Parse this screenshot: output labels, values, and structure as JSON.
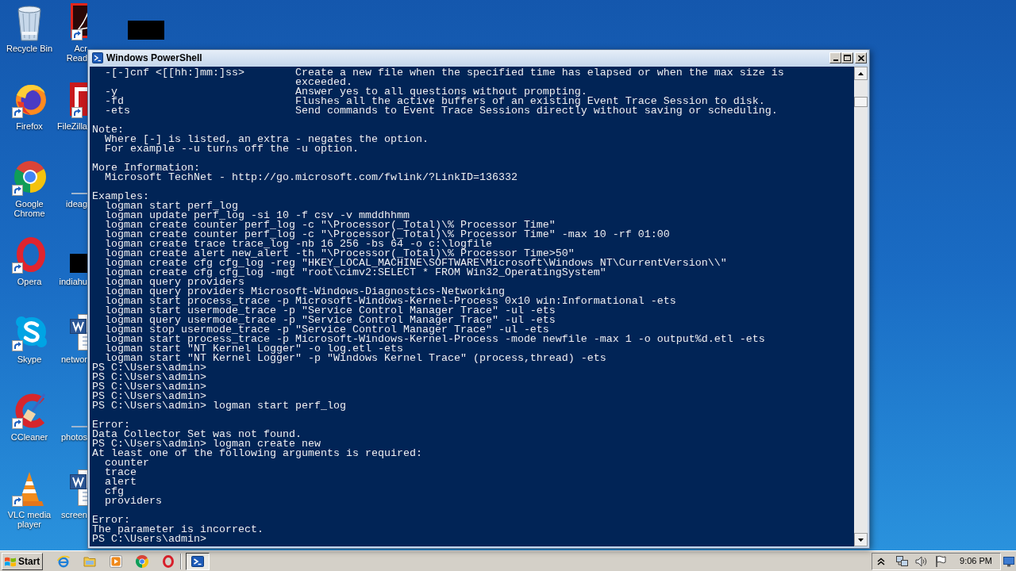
{
  "desktop": {
    "columns": [
      [
        {
          "kind": "recycle-bin",
          "label": [
            "Recycle Bin"
          ],
          "shortcut": false
        },
        {
          "kind": "firefox",
          "label": [
            "Firefox"
          ],
          "shortcut": true
        },
        {
          "kind": "chrome",
          "label": [
            "Google",
            "Chrome"
          ],
          "shortcut": true
        },
        {
          "kind": "opera",
          "label": [
            "Opera"
          ],
          "shortcut": true
        },
        {
          "kind": "skype",
          "label": [
            "Skype"
          ],
          "shortcut": true
        },
        {
          "kind": "ccleaner",
          "label": [
            "CCleaner"
          ],
          "shortcut": true
        },
        {
          "kind": "vlc",
          "label": [
            "VLC media",
            "player"
          ],
          "shortcut": true
        }
      ],
      [
        {
          "kind": "acrobat",
          "label": [
            "Acr",
            "Read"
          ],
          "shortcut": true
        },
        {
          "kind": "filezilla",
          "label": [
            "FileZilla"
          ],
          "shortcut": true
        },
        {
          "kind": "dash",
          "label": [
            "ideag"
          ],
          "shortcut": false
        },
        {
          "kind": "redacted",
          "label": [
            "indiahu"
          ],
          "shortcut": false
        },
        {
          "kind": "word",
          "label": [
            "networ"
          ],
          "shortcut": false
        },
        {
          "kind": "dash",
          "label": [
            "photos"
          ],
          "shortcut": false
        },
        {
          "kind": "word",
          "label": [
            "screen"
          ],
          "shortcut": false
        }
      ],
      [
        {
          "kind": "redacted",
          "shortcut": false
        }
      ]
    ]
  },
  "window": {
    "title": "Windows PowerShell",
    "console": {
      "blocks": [
        [
          "  -[-]cnf <[[hh:]mm:]ss>        Create a new file when the specified time has elapsed or when the max size is",
          "                                exceeded.",
          "  -y                            Answer yes to all questions without prompting.",
          "  -fd                           Flushes all the active buffers of an existing Event Trace Session to disk.",
          "  -ets                          Send commands to Event Trace Sessions directly without saving or scheduling."
        ],
        [
          "Note:",
          "  Where [-] is listed, an extra - negates the option.",
          "  For example --u turns off the -u option."
        ],
        [
          "More Information:",
          "  Microsoft TechNet - http://go.microsoft.com/fwlink/?LinkID=136332"
        ],
        [
          "Examples:",
          "  logman start perf_log",
          "  logman update perf_log -si 10 -f csv -v mmddhhmm",
          "  logman create counter perf_log -c \"\\Processor(_Total)\\% Processor Time\"",
          "  logman create counter perf_log -c \"\\Processor(_Total)\\% Processor Time\" -max 10 -rf 01:00",
          "  logman create trace trace_log -nb 16 256 -bs 64 -o c:\\logfile",
          "  logman create alert new_alert -th \"\\Processor(_Total)\\% Processor Time>50\"",
          "  logman create cfg cfg_log -reg \"HKEY_LOCAL_MACHINE\\SOFTWARE\\Microsoft\\Windows NT\\CurrentVersion\\\\\"",
          "  logman create cfg cfg_log -mgt \"root\\cimv2:SELECT * FROM Win32_OperatingSystem\"",
          "  logman query providers",
          "  logman query providers Microsoft-Windows-Diagnostics-Networking",
          "  logman start process_trace -p Microsoft-Windows-Kernel-Process 0x10 win:Informational -ets",
          "  logman start usermode_trace -p \"Service Control Manager Trace\" -ul -ets",
          "  logman query usermode_trace -p \"Service Control Manager Trace\" -ul -ets",
          "  logman stop usermode_trace -p \"Service Control Manager Trace\" -ul -ets",
          "  logman start process_trace -p Microsoft-Windows-Kernel-Process -mode newfile -max 1 -o output%d.etl -ets",
          "  logman start \"NT Kernel Logger\" -o log.etl -ets",
          "  logman start \"NT Kernel Logger\" -p \"Windows Kernel Trace\" (process,thread) -ets",
          "PS C:\\Users\\admin>",
          "PS C:\\Users\\admin>",
          "PS C:\\Users\\admin>",
          "PS C:\\Users\\admin>",
          "PS C:\\Users\\admin> logman start perf_log"
        ],
        [
          "Error:",
          "Data Collector Set was not found.",
          "PS C:\\Users\\admin> logman create new",
          "At least one of the following arguments is required:",
          "  counter",
          "  trace",
          "  alert",
          "  cfg",
          "  providers"
        ],
        [
          "Error:",
          "The parameter is incorrect.",
          "PS C:\\Users\\admin>"
        ]
      ]
    }
  },
  "taskbar": {
    "start": "Start",
    "tasks": [
      {
        "selected": true
      }
    ],
    "clock": "9:06 PM"
  }
}
